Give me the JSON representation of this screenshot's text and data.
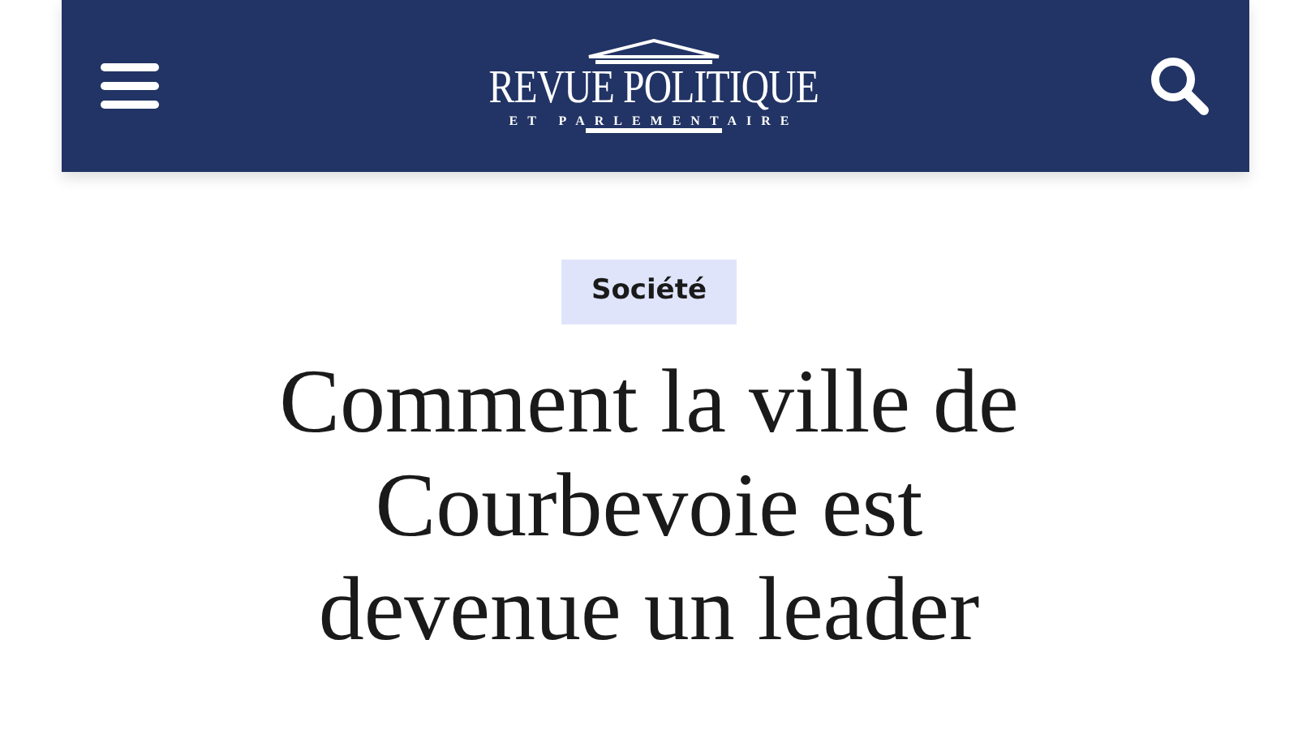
{
  "header": {
    "logo_title": "REVUE POLITIQUE",
    "logo_subtitle": "ET PARLEMENTAIRE"
  },
  "article": {
    "category": "Société",
    "title_lines": [
      "Comment la ville de",
      "Courbevoie est",
      "devenue un leader"
    ]
  }
}
